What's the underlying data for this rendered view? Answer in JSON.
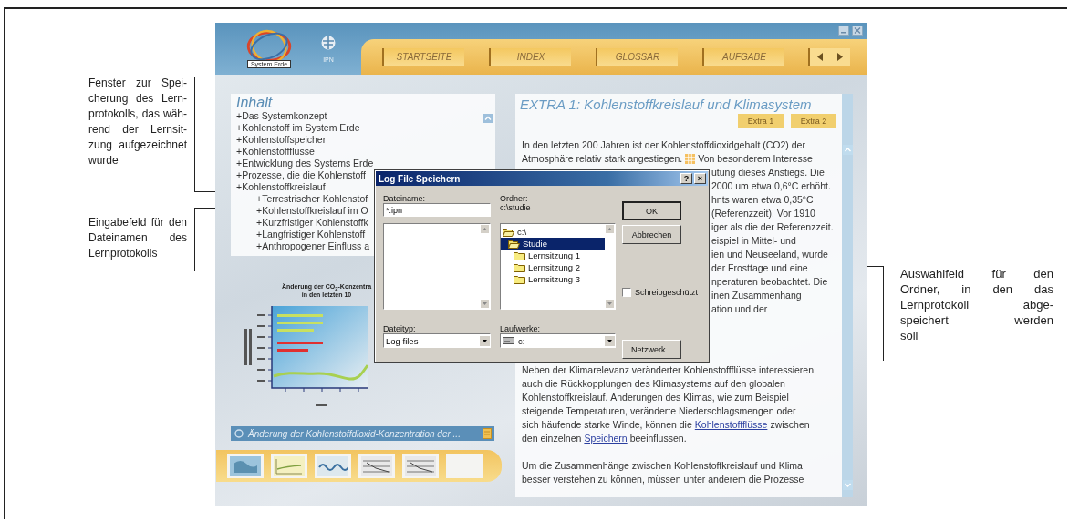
{
  "annotations_left": [
    {
      "lines": [
        "Fenster zur Spei-",
        "cherung des Lern-",
        "protokolls, das wäh-",
        "rend der Lernsit-",
        "zung aufgezeichnet",
        "wurde"
      ]
    },
    {
      "lines": [
        "Eingabefeld für den",
        "Dateinamen des",
        "Lernprotokolls"
      ]
    }
  ],
  "annotation_right": {
    "lines": [
      "Auswahlfeld für den",
      "Ordner, in den das",
      "Lernprotokoll abge-",
      "speichert werden",
      "soll"
    ]
  },
  "app": {
    "logo_label": "System Erde",
    "partner_label": "IPN",
    "nav": [
      {
        "label": "STARTSEITE"
      },
      {
        "label": "INDEX"
      },
      {
        "label": "GLOSSAR"
      },
      {
        "label": "AUFGABE"
      }
    ],
    "contents": {
      "title": "Inhalt",
      "items": [
        {
          "label": "+Das Systemkonzept"
        },
        {
          "label": "+Kohlenstoff im System Erde"
        },
        {
          "label": "+Kohlenstoffspeicher"
        },
        {
          "label": "+Kohlenstoffflüsse"
        },
        {
          "label": "+Entwicklung des Systems Erde"
        },
        {
          "label": "+Prozesse, die die Kohlenstoff"
        },
        {
          "label": "+Kohlenstoffkreislauf",
          "children": [
            {
              "label": "+Terrestrischer Kohlenstof"
            },
            {
              "label": "+Kohlenstoffkreislauf im O"
            },
            {
              "label": "+Kurzfristiger Kohlenstoffk"
            },
            {
              "label": "+Langfristiger Kohlenstoff"
            },
            {
              "label": "+Anthropogener Einfluss a"
            }
          ]
        }
      ]
    },
    "figure": {
      "title_lines": [
        "Änderung der CO$_{2}$-Konzentra",
        "in den letzten 10"
      ]
    },
    "caption": "Änderung der Kohlenstoffdioxid-Konzentration der ...",
    "thumbnails": [
      {
        "kind": "map"
      },
      {
        "kind": "graph"
      },
      {
        "kind": "wave"
      },
      {
        "kind": "table"
      },
      {
        "kind": "table"
      },
      {
        "kind": "blank"
      }
    ],
    "article": {
      "title": "EXTRA 1: Kohlenstoffkreislauf und Klimasystem",
      "tabs": [
        {
          "label": "Extra 1"
        },
        {
          "label": "Extra 2"
        }
      ],
      "paragraphs": [
        {
          "lines": [
            {
              "kind": "full",
              "segments": [
                {
                  "kind": "text",
                  "text": "In den letzten 200 Jahren ist der Kohlenstoffdioxidgehalt (CO2) der"
                }
              ]
            },
            {
              "kind": "full",
              "segments": [
                {
                  "kind": "text",
                  "text": "Atmosphäre relativ stark angestiegen."
                },
                {
                  "kind": "icon"
                },
                {
                  "kind": "text",
                  "text": "Von besonderem Interesse"
                }
              ]
            },
            {
              "kind": "fragment",
              "segments": [
                {
                  "kind": "text",
                  "text": "utung dieses Anstiegs. Die"
                }
              ]
            },
            {
              "kind": "fragment",
              "segments": [
                {
                  "kind": "text",
                  "text": "2000 um etwa 0,6°C erhöht."
                }
              ]
            },
            {
              "kind": "fragment",
              "segments": [
                {
                  "kind": "text",
                  "text": "hnts waren etwa 0,35°C"
                }
              ]
            },
            {
              "kind": "fragment",
              "segments": [
                {
                  "kind": "text",
                  "text": "(Referenzzeit). Vor 1910"
                }
              ]
            },
            {
              "kind": "fragment",
              "segments": [
                {
                  "kind": "text",
                  "text": "iger als die der Referenzzeit."
                }
              ]
            },
            {
              "kind": "fragment",
              "segments": [
                {
                  "kind": "text",
                  "text": "eispiel in Mittel- und"
                }
              ]
            },
            {
              "kind": "fragment",
              "segments": [
                {
                  "kind": "text",
                  "text": "ien und Neuseeland, wurde"
                }
              ]
            },
            {
              "kind": "fragment",
              "segments": [
                {
                  "kind": "text",
                  "text": "der Frosttage und eine"
                }
              ]
            },
            {
              "kind": "fragment",
              "segments": [
                {
                  "kind": "text",
                  "text": "nperaturen beobachtet. Die"
                }
              ]
            },
            {
              "kind": "fragment",
              "segments": [
                {
                  "kind": "text",
                  "text": "inen Zusammenhang"
                }
              ]
            },
            {
              "kind": "fragment",
              "segments": [
                {
                  "kind": "text",
                  "text": "ation und der"
                }
              ]
            }
          ]
        },
        {
          "lines": [
            {
              "kind": "full",
              "segments": [
                {
                  "kind": "text",
                  "text": "Neben der Klimarelevanz veränderter Kohlenstoffflüsse interessieren"
                }
              ]
            },
            {
              "kind": "full",
              "segments": [
                {
                  "kind": "text",
                  "text": "auch die Rückkopplungen des Klimasystems auf den globalen"
                }
              ]
            },
            {
              "kind": "full",
              "segments": [
                {
                  "kind": "text",
                  "text": "Kohlenstoffkreislauf. Änderungen des Klimas, wie zum Beispiel"
                }
              ]
            },
            {
              "kind": "full",
              "segments": [
                {
                  "kind": "text",
                  "text": "steigende Temperaturen, veränderte Niederschlagsmengen oder"
                }
              ]
            },
            {
              "kind": "full",
              "segments": [
                {
                  "kind": "text",
                  "text": "sich häufende starke Winde, können die"
                },
                {
                  "kind": "link",
                  "text": "Kohlenstoffflüsse"
                },
                {
                  "kind": "text",
                  "text": "zwischen"
                }
              ]
            },
            {
              "kind": "full",
              "segments": [
                {
                  "kind": "text",
                  "text": "den einzelnen"
                },
                {
                  "kind": "link",
                  "text": "Speichern"
                },
                {
                  "kind": "text",
                  "text": "beeinflussen."
                }
              ]
            }
          ]
        },
        {
          "lines": [
            {
              "kind": "full",
              "segments": [
                {
                  "kind": "text",
                  "text": "Um die Zusammenhänge zwischen Kohlenstoffkreislauf und Klima"
                }
              ]
            },
            {
              "kind": "full",
              "segments": [
                {
                  "kind": "text",
                  "text": "besser verstehen zu können, müssen unter anderem die Prozesse"
                }
              ]
            }
          ]
        }
      ]
    }
  },
  "dialog": {
    "title": "Log File Speichern",
    "help_button": "?",
    "close_button": "×",
    "filename_label": "Dateiname:",
    "filename_value": "*.ipn",
    "folder_label": "Ordner:",
    "folder_path": "c:\\studie",
    "folders": [
      {
        "label": "c:\\",
        "kind": "open_folder",
        "selected": false,
        "children": [
          {
            "label": "Studie",
            "kind": "open_folder",
            "selected": true,
            "children": [
              {
                "label": "Lernsitzung 1",
                "kind": "folder",
                "selected": false
              },
              {
                "label": "Lernsitzung 2",
                "kind": "folder",
                "selected": false
              },
              {
                "label": "Lernsitzung 3",
                "kind": "folder",
                "selected": false
              }
            ]
          }
        ]
      }
    ],
    "filetype_label": "Dateityp:",
    "filetype_value": "Log files",
    "drives_label": "Laufwerke:",
    "drive_value": "c:",
    "ok_button": "OK",
    "cancel_button": "Abbrechen",
    "network_button": "Netzwerk...",
    "readonly": {
      "label": "Schreibgeschützt",
      "checked": false
    }
  }
}
